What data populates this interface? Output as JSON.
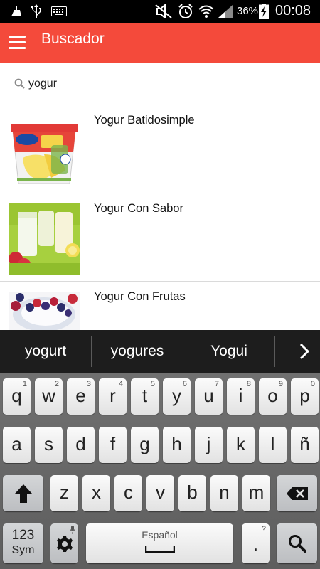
{
  "status_bar": {
    "battery_percent": "36%",
    "time": "00:08"
  },
  "app_bar": {
    "title": "Buscador"
  },
  "search": {
    "query": "yogur"
  },
  "results": [
    {
      "title": "Yogur Batidosimple",
      "image": "colun-yogurt-cup"
    },
    {
      "title": "Yogur Con Sabor",
      "image": "yogurt-glasses"
    },
    {
      "title": "Yogur Con Frutas",
      "image": "yogurt-bowl-berries"
    }
  ],
  "suggestions": [
    "yogurt",
    "yogures",
    "Yogui"
  ],
  "keyboard": {
    "row1": [
      {
        "key": "q",
        "hint": "1"
      },
      {
        "key": "w",
        "hint": "2"
      },
      {
        "key": "e",
        "hint": "3"
      },
      {
        "key": "r",
        "hint": "4"
      },
      {
        "key": "t",
        "hint": "5"
      },
      {
        "key": "y",
        "hint": "6"
      },
      {
        "key": "u",
        "hint": "7"
      },
      {
        "key": "i",
        "hint": "8"
      },
      {
        "key": "o",
        "hint": "9"
      },
      {
        "key": "p",
        "hint": "0"
      }
    ],
    "row2": [
      "a",
      "s",
      "d",
      "f",
      "g",
      "h",
      "j",
      "k",
      "l",
      "ñ"
    ],
    "row3": [
      "z",
      "x",
      "c",
      "v",
      "b",
      "n",
      "m"
    ],
    "sym_key_line1": "123",
    "sym_key_line2": "Sym",
    "space_label": "Español",
    "period_key": ".",
    "period_hint": "?"
  },
  "colors": {
    "app_bar": "#f44a3b",
    "status_bar": "#000000",
    "suggestion_bar": "#1d1d1d",
    "keyboard_bg": "#666666"
  }
}
